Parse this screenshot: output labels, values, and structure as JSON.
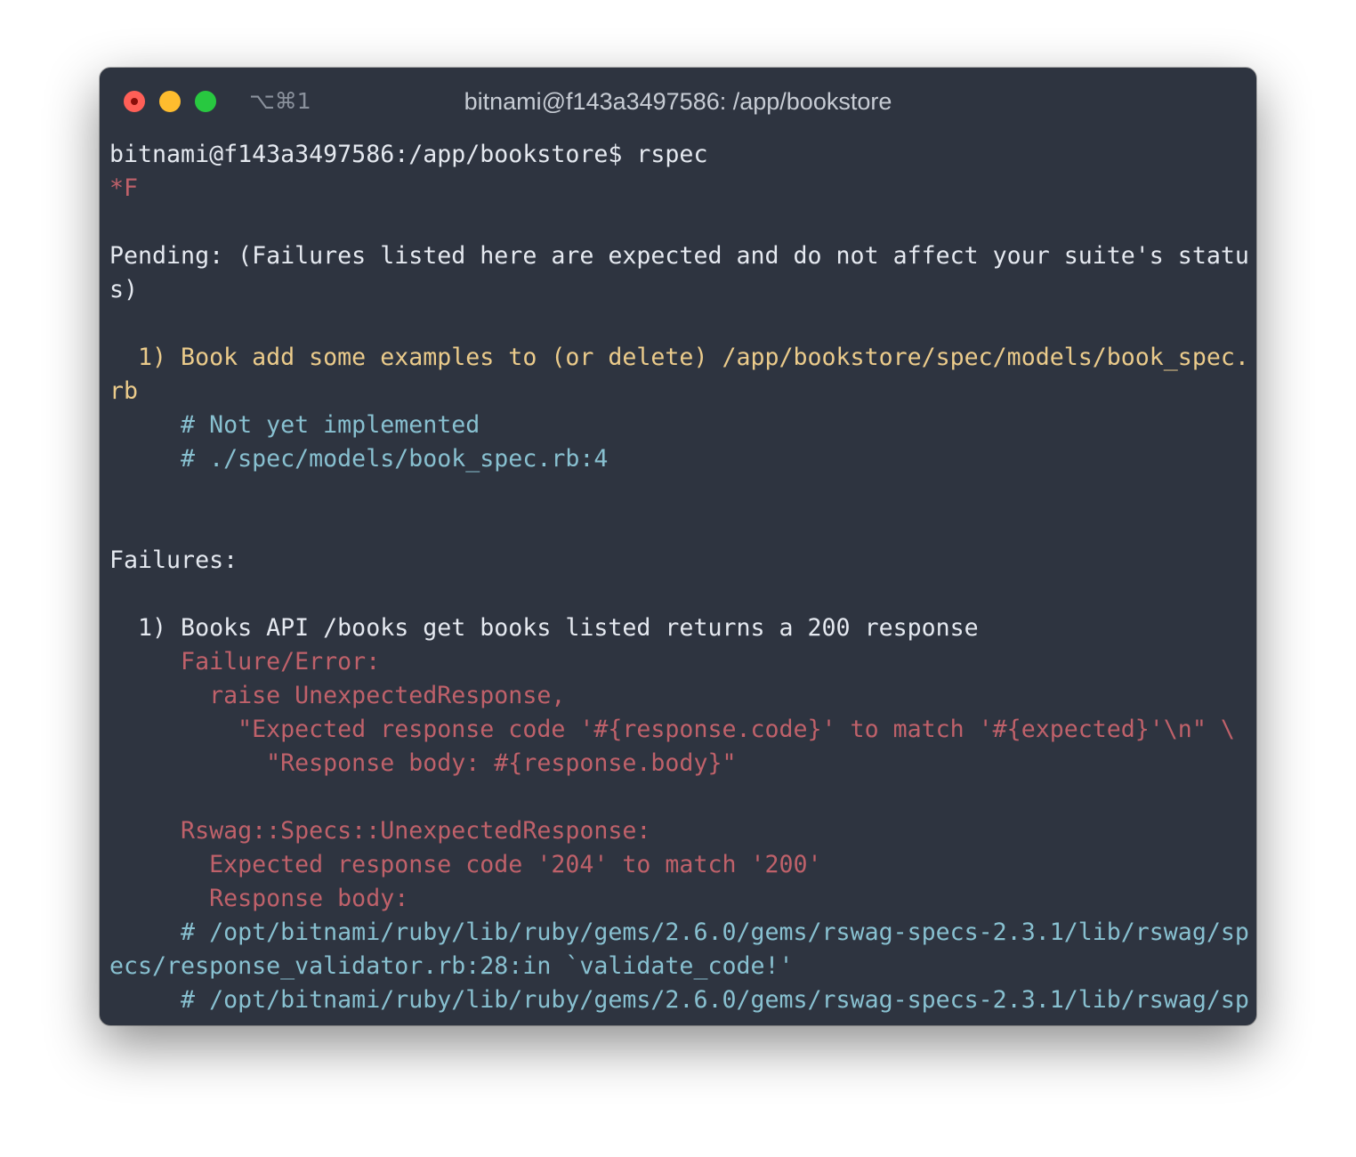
{
  "window": {
    "title": "bitnami@f143a3497586: /app/bookstore",
    "shortcut": "⌥⌘1",
    "traffic_lights": {
      "close": "#ff5f57",
      "minimize": "#febc2e",
      "maximize": "#28c840"
    }
  },
  "colors": {
    "background": "#2e3440",
    "default_text": "#e5e9f0",
    "pending_yellow": "#ebcb8b",
    "error_red": "#bf616a",
    "comment_cyan": "#88c0d0"
  },
  "terminal": {
    "lines": [
      {
        "text": "bitnami@f143a3497586:/app/bookstore$ rspec",
        "color": "white"
      },
      {
        "text": "*F",
        "color": "red"
      },
      {
        "text": "",
        "color": "white"
      },
      {
        "text": "Pending: (Failures listed here are expected and do not affect your suite's statu",
        "color": "white"
      },
      {
        "text": "s)",
        "color": "white"
      },
      {
        "text": "",
        "color": "white"
      },
      {
        "text": "  1) Book add some examples to (or delete) /app/bookstore/spec/models/book_spec.",
        "color": "yellow"
      },
      {
        "text": "rb",
        "color": "yellow"
      },
      {
        "text": "     # Not yet implemented",
        "color": "cyan"
      },
      {
        "text": "     # ./spec/models/book_spec.rb:4",
        "color": "cyan"
      },
      {
        "text": "",
        "color": "white"
      },
      {
        "text": "",
        "color": "white"
      },
      {
        "text": "Failures:",
        "color": "white"
      },
      {
        "text": "",
        "color": "white"
      },
      {
        "text": "  1) Books API /books get books listed returns a 200 response",
        "color": "white"
      },
      {
        "text": "     Failure/Error:",
        "color": "red"
      },
      {
        "text": "       raise UnexpectedResponse,",
        "color": "red"
      },
      {
        "text": "         \"Expected response code '#{response.code}' to match '#{expected}'\\n\" \\",
        "color": "red"
      },
      {
        "text": "           \"Response body: #{response.body}\"",
        "color": "red"
      },
      {
        "text": "",
        "color": "white"
      },
      {
        "text": "     Rswag::Specs::UnexpectedResponse:",
        "color": "red"
      },
      {
        "text": "       Expected response code '204' to match '200'",
        "color": "red"
      },
      {
        "text": "       Response body:",
        "color": "red"
      },
      {
        "text": "     # /opt/bitnami/ruby/lib/ruby/gems/2.6.0/gems/rswag-specs-2.3.1/lib/rswag/sp",
        "color": "cyan"
      },
      {
        "text": "ecs/response_validator.rb:28:in `validate_code!'",
        "color": "cyan"
      },
      {
        "text": "     # /opt/bitnami/ruby/lib/ruby/gems/2.6.0/gems/rswag-specs-2.3.1/lib/rswag/sp",
        "color": "cyan"
      }
    ]
  }
}
